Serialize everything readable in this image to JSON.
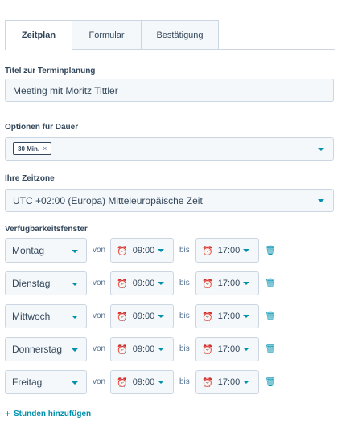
{
  "tabs": [
    {
      "label": "Zeitplan",
      "active": true
    },
    {
      "label": "Formular",
      "active": false
    },
    {
      "label": "Bestätigung",
      "active": false
    }
  ],
  "title_field": {
    "label": "Titel zur Terminplanung",
    "value": "Meeting mit Moritz Tittler"
  },
  "duration": {
    "label": "Optionen für Dauer",
    "chips": [
      "30 Min."
    ],
    "chip_remove": "×"
  },
  "timezone": {
    "label": "Ihre Zeitzone",
    "value": "UTC +02:00 (Europa) Mitteleuropäische Zeit"
  },
  "availability": {
    "label": "Verfügbarkeitsfenster",
    "von_label": "von",
    "bis_label": "bis",
    "rows": [
      {
        "day": "Montag",
        "start": "09:00",
        "end": "17:00"
      },
      {
        "day": "Dienstag",
        "start": "09:00",
        "end": "17:00"
      },
      {
        "day": "Mittwoch",
        "start": "09:00",
        "end": "17:00"
      },
      {
        "day": "Donnerstag",
        "start": "09:00",
        "end": "17:00"
      },
      {
        "day": "Freitag",
        "start": "09:00",
        "end": "17:00"
      }
    ]
  },
  "add_hours": {
    "icon": "+",
    "label": "Stunden hinzufügen"
  },
  "colors": {
    "accent": "#0091ae",
    "text": "#33475b",
    "border": "#cbd6e2",
    "field_bg": "#f5f8fa"
  },
  "icons": {
    "clock": "clock-icon",
    "trash": "trash-icon",
    "caret": "caret-down-icon"
  }
}
